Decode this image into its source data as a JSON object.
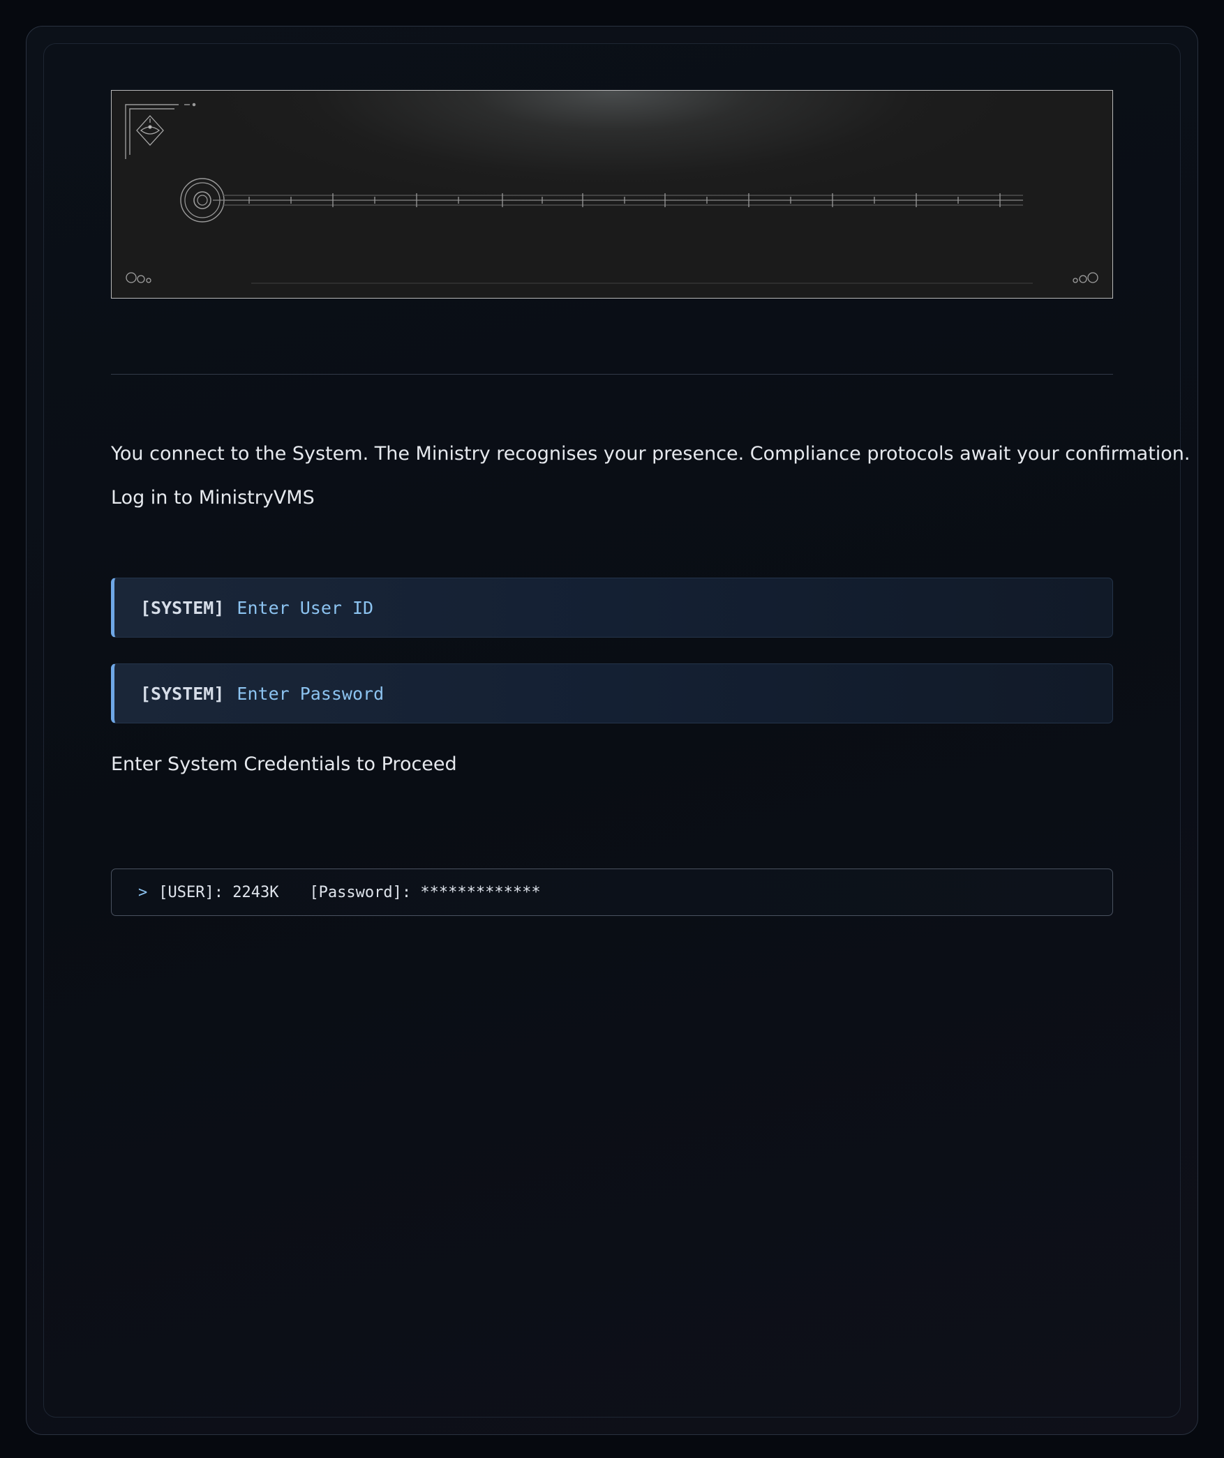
{
  "intro": {
    "message": "You connect to the System. The Ministry recognises your presence. Compliance protocols await your confirmation."
  },
  "login": {
    "heading": "Log in to MinistryVMS",
    "user_field": {
      "tag": "[SYSTEM]",
      "prompt": "Enter User ID"
    },
    "password_field": {
      "tag": "[SYSTEM]",
      "prompt": "Enter Password"
    },
    "proceed_text": "Enter System Credentials to Proceed"
  },
  "console": {
    "caret": ">",
    "user_label": "[USER]: 2243K",
    "password_label": "[Password]: *************"
  },
  "colors": {
    "background": "#06090f",
    "accent": "#6fa7e6",
    "prompt_text": "#8cc3f0",
    "body_text": "#e6e9ee"
  },
  "icons": {
    "banner_emblem": "diamond-eye-icon",
    "banner_dial": "concentric-circle-icon"
  }
}
